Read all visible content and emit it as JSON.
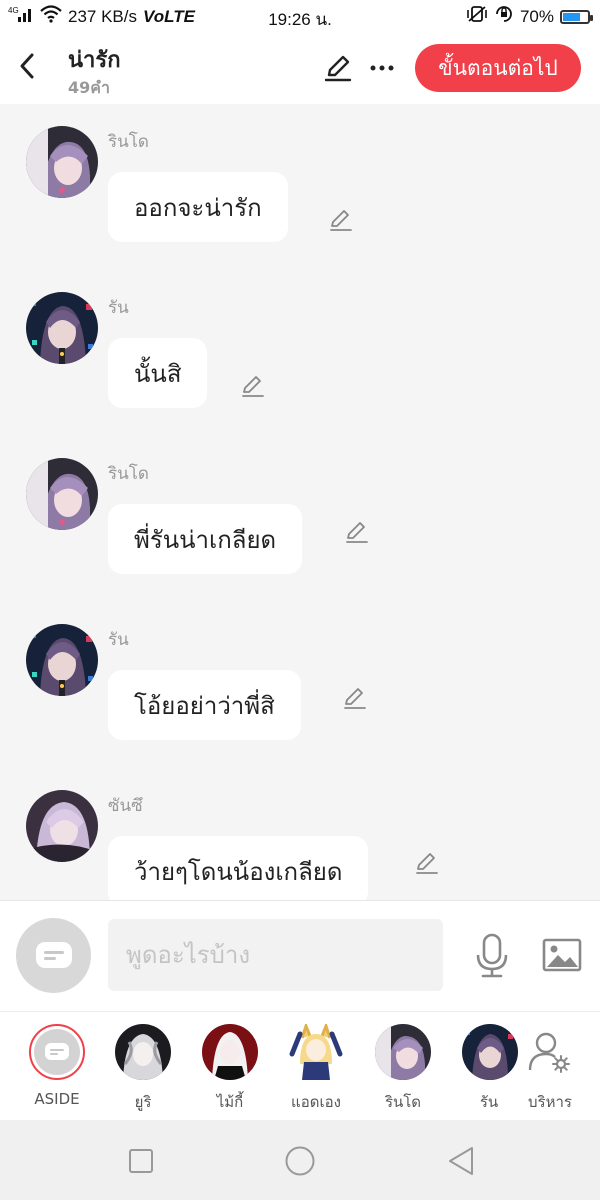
{
  "status_bar": {
    "signal": "4G",
    "speed": "237 KB/s",
    "network": "VoLTE",
    "time": "19:26 น.",
    "battery": "70%",
    "battery_level": 0.7
  },
  "header": {
    "title": "น่ารัก",
    "word_count": "49คำ",
    "next_label": "ขั้นตอนต่อไป"
  },
  "messages": [
    {
      "name": "รินโด",
      "text": "ออกจะน่ารัก"
    },
    {
      "name": "รัน",
      "text": "นั้นสิ"
    },
    {
      "name": "รินโด",
      "text": "พี่รันน่าเกลียด"
    },
    {
      "name": "รัน",
      "text": "โอ้ยอย่าว่าพี่สิ"
    },
    {
      "name": "ซันซึ",
      "text": "ว้ายๆโดนน้องเกลียด"
    }
  ],
  "input": {
    "placeholder": "พูดอะไรบ้าง"
  },
  "characters": [
    {
      "label": "ASIDE"
    },
    {
      "label": "ยูริ"
    },
    {
      "label": "ไม้กี้"
    },
    {
      "label": "แอดเอง"
    },
    {
      "label": "รินโด"
    },
    {
      "label": "รัน"
    },
    {
      "label": "บริหาร"
    }
  ],
  "colors": {
    "accent": "#f2404a",
    "bubble": "#ffffff",
    "background": "#f5f5f5"
  }
}
